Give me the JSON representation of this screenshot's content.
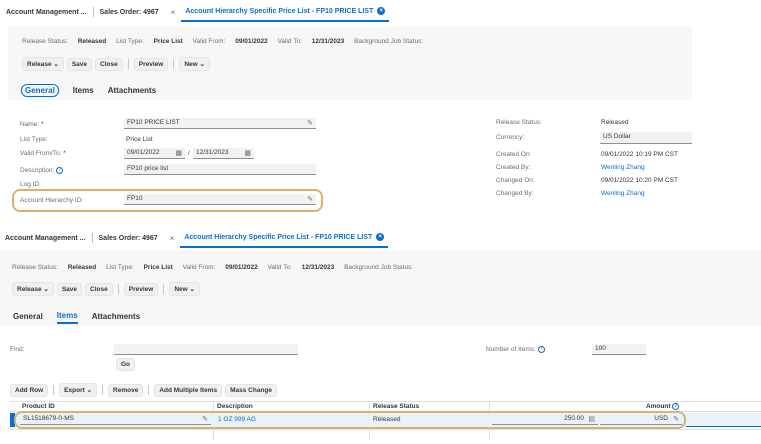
{
  "top": {
    "tabs": [
      "Account Management ...",
      "Sales Order: 4967",
      "Account Hierarchy Specific Price List - FP10 PRICE LIST"
    ],
    "status": {
      "release_status_label": "Release Status:",
      "release_status_value": "Released",
      "list_type_label": "List Type:",
      "list_type_value": "Price List",
      "valid_from_label": "Valid From:",
      "valid_from_value": "09/01/2022",
      "valid_to_label": "Valid To:",
      "valid_to_value": "12/31/2023",
      "bg_job_label": "Background Job Status:"
    },
    "buttons": [
      "Release",
      "Save",
      "Close",
      "Preview",
      "New"
    ],
    "subtabs": [
      "General",
      "Items",
      "Attachments"
    ],
    "form": {
      "name_label": "Name:",
      "name_value": "FP10 PRICE LIST",
      "list_type_label": "List Type:",
      "list_type_value": "Price List",
      "valid_label": "Valid From/To:",
      "valid_from": "09/01/2022",
      "valid_to": "12/31/2023",
      "desc_label": "Description:",
      "desc_value": "FP10 price list",
      "log_label": "Log ID:",
      "ahid_label": "Account Hierarchy ID:",
      "ahid_value": "FP10",
      "rs_label": "Release Status:",
      "rs_value": "Released",
      "currency_label": "Currency:",
      "currency_value": "US Dollar",
      "created_on_label": "Created On:",
      "created_on_value": "09/01/2022 10:19 PM CST",
      "created_by_label": "Created By:",
      "created_by_value": "Wenling Zhang",
      "changed_on_label": "Changed On:",
      "changed_on_value": "09/01/2022 10:20 PM CST",
      "changed_by_label": "Changed By:",
      "changed_by_value": "Wenling Zhang"
    }
  },
  "bottom": {
    "tabs": [
      "Account Management ...",
      "Sales Order: 4967",
      "Account Hierarchy Specific Price List - FP10 PRICE LIST"
    ],
    "status": {
      "release_status_label": "Release Status:",
      "release_status_value": "Released",
      "list_type_label": "List Type:",
      "list_type_value": "Price List",
      "valid_from_label": "Valid From:",
      "valid_from_value": "09/01/2022",
      "valid_to_label": "Valid To:",
      "valid_to_value": "12/31/2023",
      "bg_job_label": "Background Job Status:"
    },
    "buttons": [
      "Release",
      "Save",
      "Close",
      "Preview",
      "New"
    ],
    "subtabs": [
      "General",
      "Items",
      "Attachments"
    ],
    "find_label": "Find:",
    "go_label": "Go",
    "num_items_label": "Number of Items:",
    "num_items_value": "100",
    "table_buttons": [
      "Add Row",
      "Export",
      "Remove",
      "Add Multiple Items",
      "Mass Change"
    ],
    "columns": [
      "Product ID",
      "Description",
      "Release Status",
      "Amount"
    ],
    "row": {
      "product_id": "SL1518679-0-MS",
      "description": "1 OZ 999 AG",
      "release_status": "Released",
      "amount": "250.00",
      "currency": "USD"
    }
  }
}
